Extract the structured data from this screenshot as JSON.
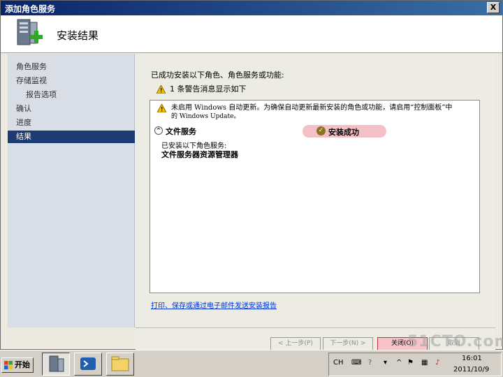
{
  "window": {
    "title": "添加角色服务",
    "close_label": "X"
  },
  "header": {
    "title": "安装结果",
    "icon": "server-add-icon"
  },
  "sidebar": {
    "items": [
      {
        "label": "角色服务"
      },
      {
        "label": "存储监视"
      },
      {
        "label": "报告选项"
      },
      {
        "label": "确认"
      },
      {
        "label": "进度"
      },
      {
        "label": "结果"
      }
    ],
    "active_index": 5
  },
  "main": {
    "intro": "已成功安装以下角色、角色服务或功能:",
    "warning_summary": "1 条警告消息显示如下",
    "warning_message_line1": "未启用 Windows 自动更新。为确保自动更新最新安装的角色或功能，请启用“控制面板”中",
    "warning_message_line2": "的 Windows Update。",
    "section_title": "文件服务",
    "status": "安装成功",
    "installed_caption": "已安装以下角色服务:",
    "installed_item": "文件服务器资源管理器",
    "report_link": "打印、保存或通过电子邮件发送安装报告"
  },
  "footer": {
    "prev_label": "< 上一步(P)",
    "next_label": "下一步(N) >",
    "close_label": "关闭(O)",
    "cancel_label": "取消"
  },
  "watermark": "51CTO.com",
  "taskbar": {
    "start_label": "开始",
    "lang": "CH",
    "time": "16:01",
    "date": "2011/10/9"
  },
  "colors": {
    "title_bar": "#0a246a",
    "selected_nav": "#1c3a73",
    "status_badge": "#f3c0c6",
    "link": "#0033cc"
  }
}
